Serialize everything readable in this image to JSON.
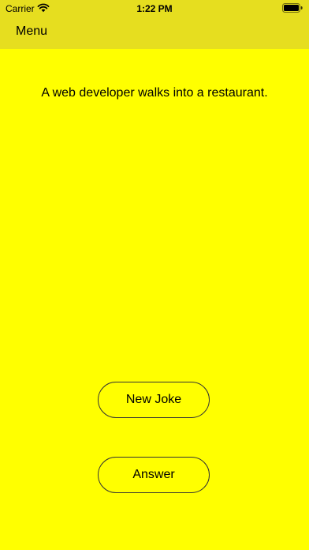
{
  "status_bar": {
    "carrier": "Carrier",
    "time": "1:22 PM"
  },
  "nav": {
    "menu_label": "Menu"
  },
  "joke": {
    "text": "A web developer walks into a restaurant."
  },
  "buttons": {
    "new_joke_label": "New Joke",
    "answer_label": "Answer"
  },
  "colors": {
    "background": "#ffff00",
    "top_bar": "#e6de1f"
  },
  "icons": {
    "wifi": "wifi-icon",
    "battery": "battery-icon"
  }
}
